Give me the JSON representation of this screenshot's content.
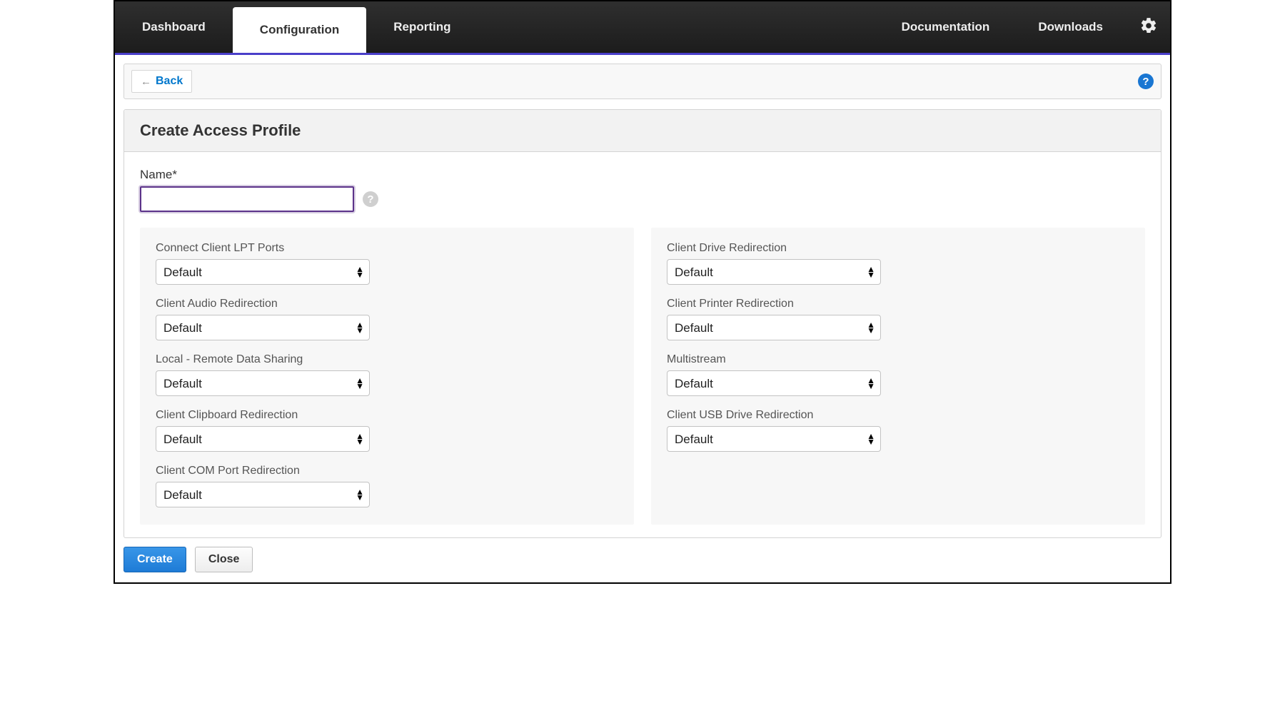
{
  "nav": {
    "tabs": [
      {
        "label": "Dashboard"
      },
      {
        "label": "Configuration",
        "active": true
      },
      {
        "label": "Reporting"
      }
    ],
    "right_links": [
      {
        "label": "Documentation"
      },
      {
        "label": "Downloads"
      }
    ],
    "gear_icon": "gear-icon"
  },
  "toolbar": {
    "back_label": "Back",
    "help_label": "?"
  },
  "panel": {
    "title": "Create Access Profile",
    "name_label": "Name*",
    "name_value": "",
    "hint_label": "?",
    "left_fields": [
      {
        "label": "Connect Client LPT Ports",
        "value": "Default"
      },
      {
        "label": "Client Audio Redirection",
        "value": "Default"
      },
      {
        "label": "Local - Remote Data Sharing",
        "value": "Default"
      },
      {
        "label": "Client Clipboard Redirection",
        "value": "Default"
      },
      {
        "label": "Client COM Port Redirection",
        "value": "Default"
      }
    ],
    "right_fields": [
      {
        "label": "Client Drive Redirection",
        "value": "Default"
      },
      {
        "label": "Client Printer Redirection",
        "value": "Default"
      },
      {
        "label": "Multistream",
        "value": "Default"
      },
      {
        "label": "Client USB Drive Redirection",
        "value": "Default"
      }
    ]
  },
  "footer": {
    "create_label": "Create",
    "close_label": "Close"
  }
}
